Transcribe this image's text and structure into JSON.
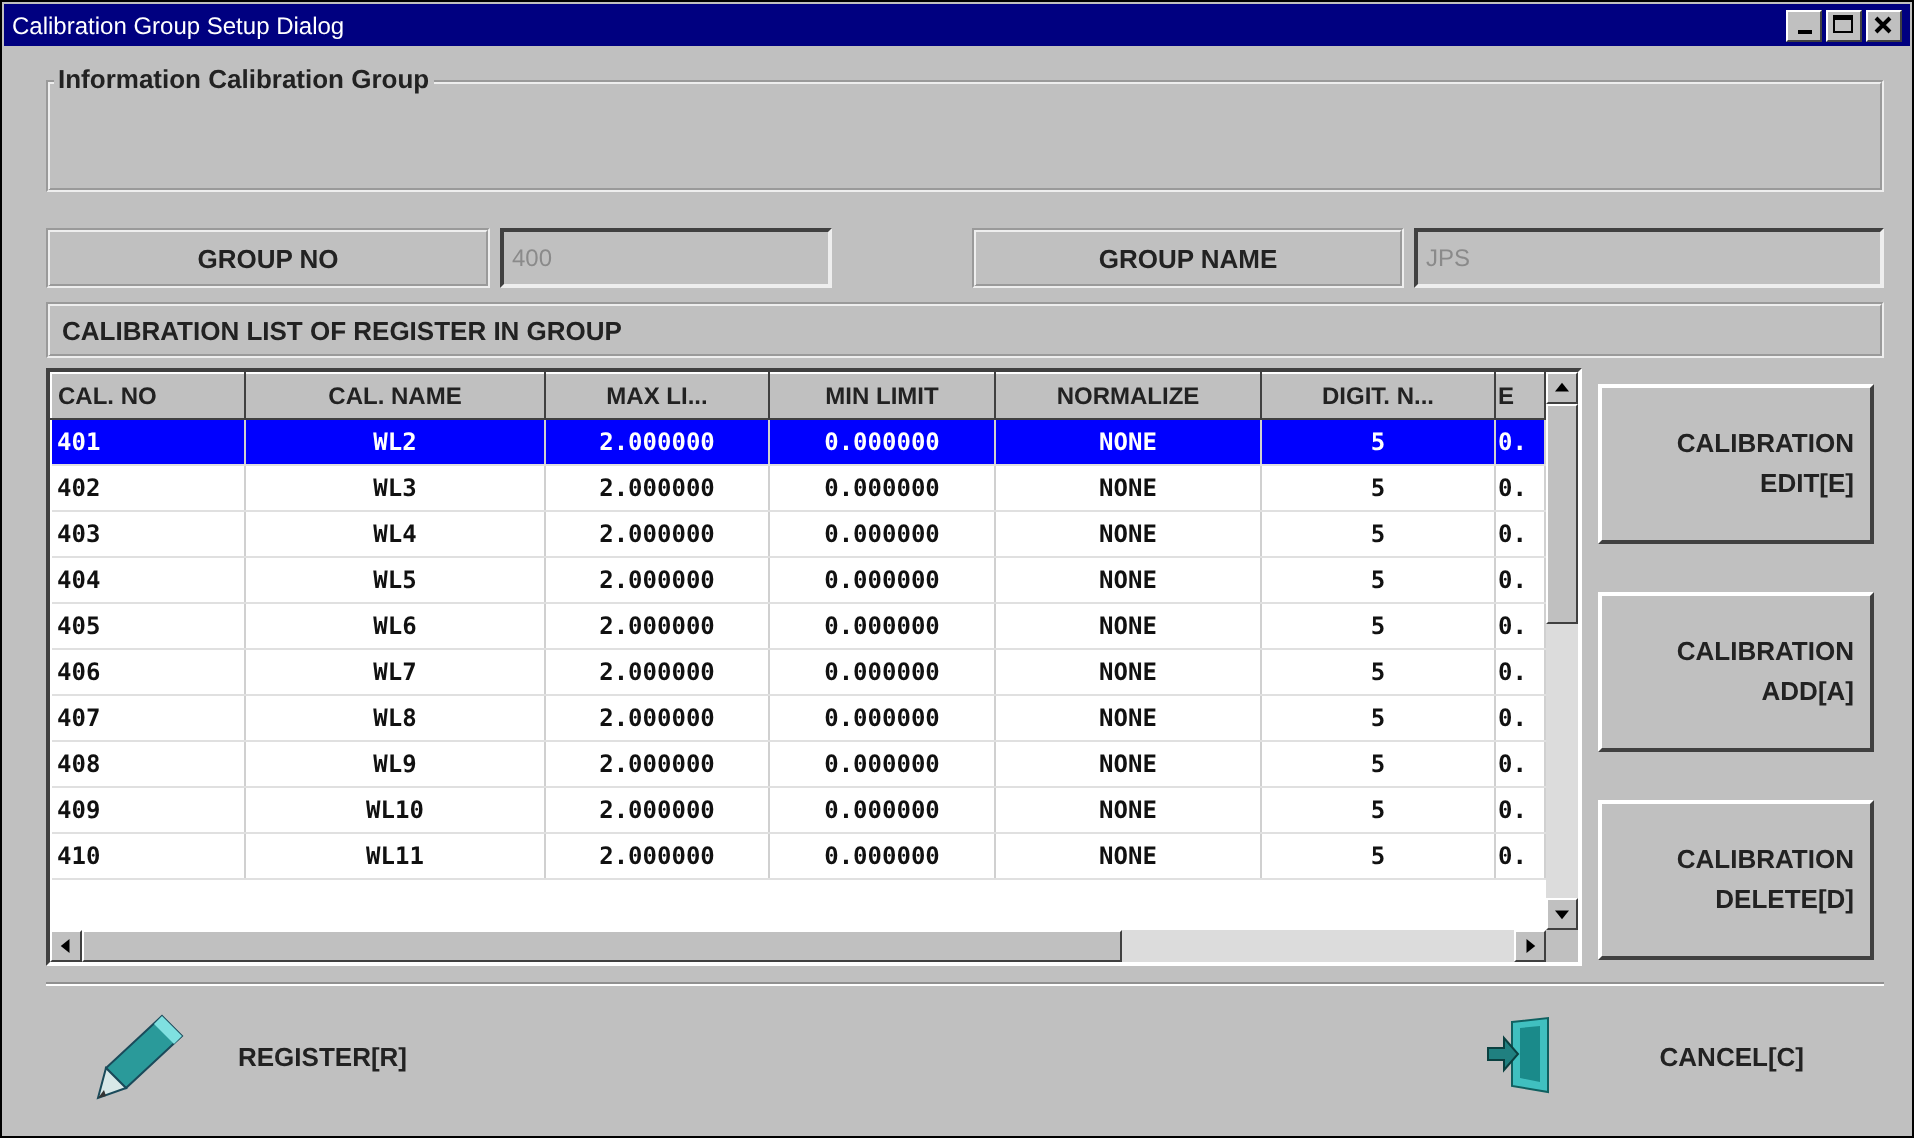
{
  "window": {
    "title": "Calibration Group Setup Dialog"
  },
  "info_group": {
    "title": "Information Calibration Group"
  },
  "group_no": {
    "label": "GROUP NO",
    "value": "400",
    "disabled": true
  },
  "group_name": {
    "label": "GROUP NAME",
    "value": "JPS",
    "disabled": true
  },
  "list_caption": "CALIBRATION LIST OF REGISTER IN GROUP",
  "table": {
    "columns": [
      "CAL. NO",
      "CAL. NAME",
      "MAX LI...",
      "MIN LIMIT",
      "NORMALIZE",
      "DIGIT. N...",
      "E"
    ],
    "rows": [
      {
        "cells": [
          "401",
          "WL2",
          "2.000000",
          "0.000000",
          "NONE",
          "5",
          "0."
        ],
        "selected": true
      },
      {
        "cells": [
          "402",
          "WL3",
          "2.000000",
          "0.000000",
          "NONE",
          "5",
          "0."
        ],
        "selected": false
      },
      {
        "cells": [
          "403",
          "WL4",
          "2.000000",
          "0.000000",
          "NONE",
          "5",
          "0."
        ],
        "selected": false
      },
      {
        "cells": [
          "404",
          "WL5",
          "2.000000",
          "0.000000",
          "NONE",
          "5",
          "0."
        ],
        "selected": false
      },
      {
        "cells": [
          "405",
          "WL6",
          "2.000000",
          "0.000000",
          "NONE",
          "5",
          "0."
        ],
        "selected": false
      },
      {
        "cells": [
          "406",
          "WL7",
          "2.000000",
          "0.000000",
          "NONE",
          "5",
          "0."
        ],
        "selected": false
      },
      {
        "cells": [
          "407",
          "WL8",
          "2.000000",
          "0.000000",
          "NONE",
          "5",
          "0."
        ],
        "selected": false
      },
      {
        "cells": [
          "408",
          "WL9",
          "2.000000",
          "0.000000",
          "NONE",
          "5",
          "0."
        ],
        "selected": false
      },
      {
        "cells": [
          "409",
          "WL10",
          "2.000000",
          "0.000000",
          "NONE",
          "5",
          "0."
        ],
        "selected": false
      },
      {
        "cells": [
          "410",
          "WL11",
          "2.000000",
          "0.000000",
          "NONE",
          "5",
          "0."
        ],
        "selected": false
      }
    ]
  },
  "side_buttons": [
    "CALIBRATION EDIT[E]",
    "CALIBRATION ADD[A]",
    "CALIBRATION DELETE[D]"
  ],
  "footer_buttons": [
    {
      "label": "REGISTER[R]",
      "kind": "register"
    },
    {
      "label": "CANCEL[C]",
      "kind": "cancel"
    }
  ]
}
